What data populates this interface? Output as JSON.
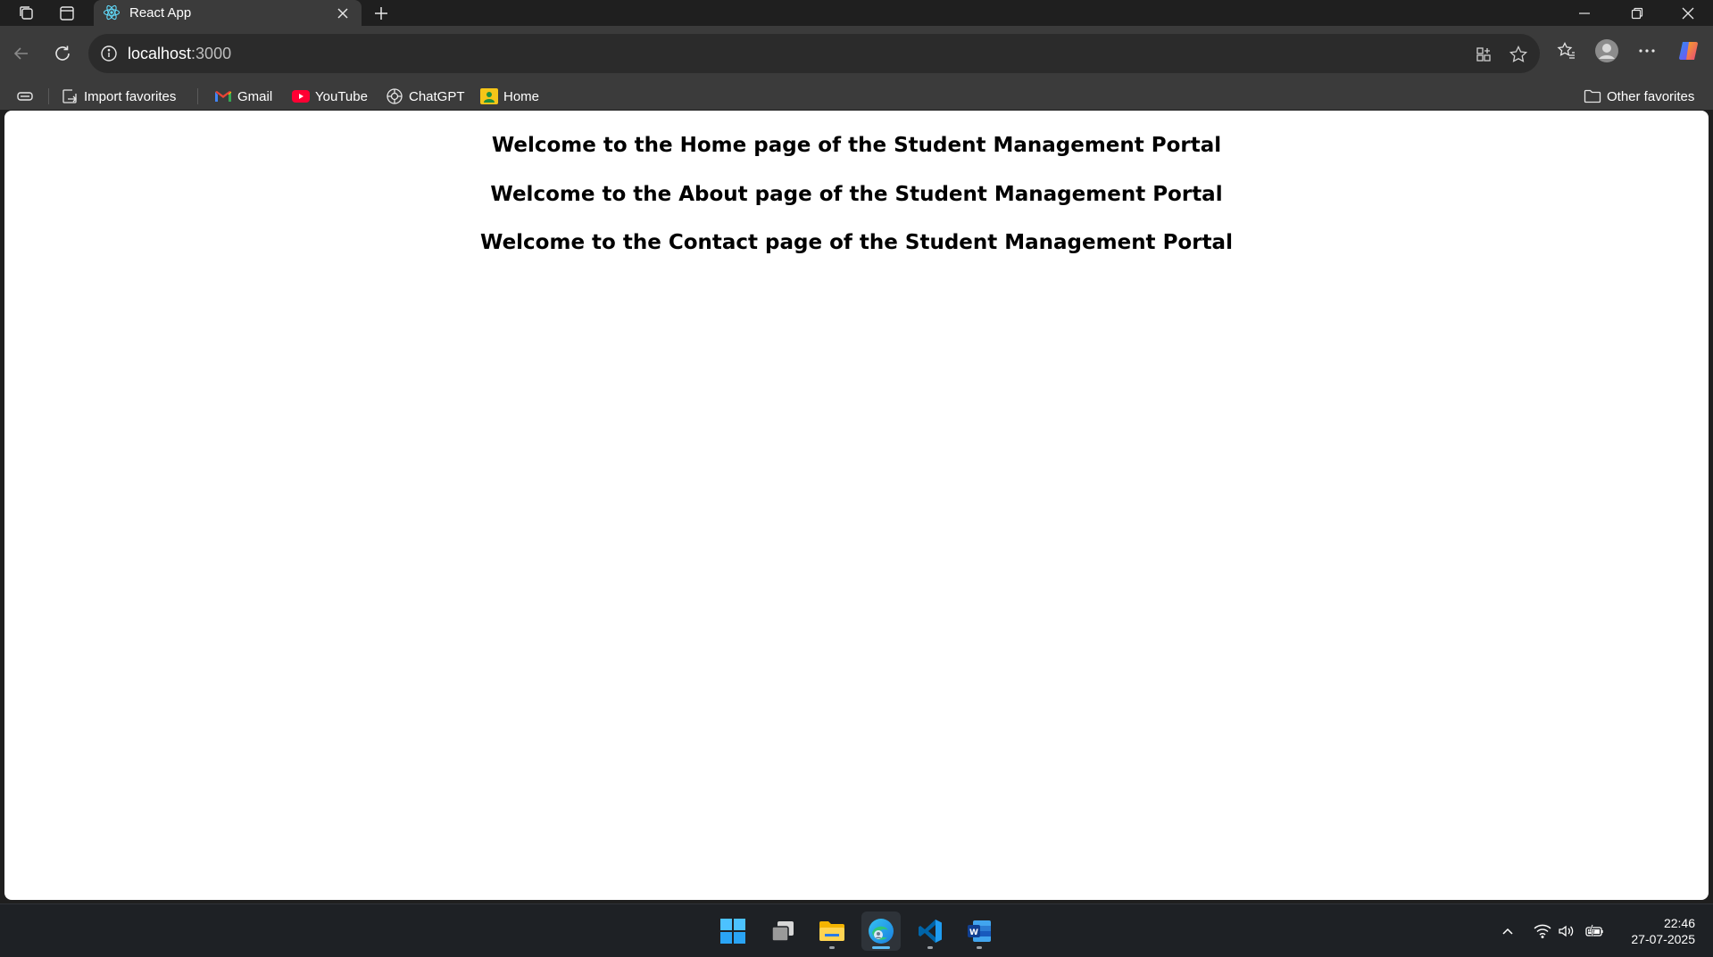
{
  "browser": {
    "tab": {
      "title": "React App",
      "favicon": "react-icon"
    },
    "address": {
      "host": "localhost",
      "port": ":3000"
    },
    "bookmarks": [
      {
        "label": "Import favorites",
        "icon": "import-icon"
      },
      {
        "label": "Gmail",
        "icon": "gmail-icon"
      },
      {
        "label": "YouTube",
        "icon": "youtube-icon"
      },
      {
        "label": "ChatGPT",
        "icon": "chatgpt-icon"
      },
      {
        "label": "Home",
        "icon": "home-icon"
      }
    ],
    "other_favorites": "Other favorites"
  },
  "page": {
    "headings": [
      "Welcome to the Home page of the Student Management Portal",
      "Welcome to the About page of the Student Management Portal",
      "Welcome to the Contact page of the Student Management Portal"
    ]
  },
  "taskbar": {
    "apps": [
      "windows-start-icon",
      "task-view-icon",
      "file-explorer-icon",
      "edge-icon",
      "vscode-icon",
      "word-icon"
    ],
    "time": "22:46",
    "date": "27-07-2025"
  },
  "colors": {
    "frame": "#1f1f1f",
    "toolbar": "#3b3b3b",
    "page_bg": "#ffffff",
    "heading_text": "#000000"
  }
}
